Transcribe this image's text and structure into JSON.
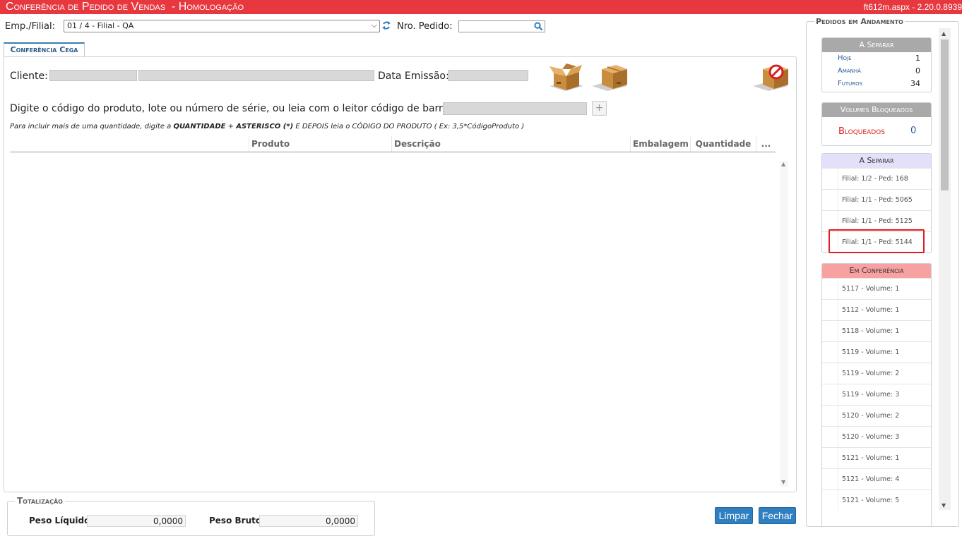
{
  "window": {
    "title": "Conferência de Pedido de Vendas",
    "environment": "- Homologação",
    "version": "ft612m.aspx - 2.20.0.8939"
  },
  "filters": {
    "emp_label": "Emp./Filial:",
    "emp_value": "01 / 4 - Filial - QA",
    "pedido_label": "Nro. Pedido:",
    "pedido_value": ""
  },
  "tab": {
    "label": "Conferência Cega"
  },
  "form": {
    "cliente_label": "Cliente:",
    "data_emissao_label": "Data Emissão:",
    "barcode_label": "Digite o código do produto, lote ou número de série, ou leia com o leitor código de barras:",
    "add_label": "+",
    "hint": {
      "p1": "Para incluir mais de uma quantidade, digite a ",
      "b1": "QUANTIDADE",
      "p2": " + ",
      "b2": "ASTERISCO (*)",
      "p3": " E DEPOIS leia o CÓDIGO DO PRODUTO ( Ex: 3,5*CódigoProduto )"
    }
  },
  "grid": {
    "columns": [
      "",
      "Produto",
      "Descrição",
      "Embalagem",
      "Quantidade",
      "..."
    ],
    "rows": []
  },
  "totals": {
    "title": "Totalização",
    "peso_liquido_label": "Peso Líquido:",
    "peso_liquido": "0,0000",
    "peso_bruto_label": "Peso Bruto:",
    "peso_bruto": "0,0000"
  },
  "buttons": {
    "limpar": "Limpar",
    "fechar": "Fechar"
  },
  "sidebar": {
    "title": "Pedidos em Andamento",
    "summary": {
      "title": "A Separar",
      "rows": [
        {
          "label": "Hoje",
          "value": "1"
        },
        {
          "label": "Amanhã",
          "value": "0"
        },
        {
          "label": "Futuros",
          "value": "34"
        }
      ]
    },
    "blocked": {
      "title": "Volumes Bloqueados",
      "label": "Bloqueados",
      "value": "0"
    },
    "a_separar": {
      "title": "A Separar",
      "items": [
        "Filial: 1/2 - Ped: 168",
        "Filial: 1/1 - Ped: 5065",
        "Filial: 1/1 - Ped: 5125",
        "Filial: 1/1 - Ped: 5144"
      ]
    },
    "em_conferencia": {
      "title": "Em Conferência",
      "items": [
        "5117 - Volume: 1",
        "5112 - Volume: 1",
        "5118 - Volume: 1",
        "5119 - Volume: 1",
        "5119 - Volume: 2",
        "5119 - Volume: 3",
        "5120 - Volume: 2",
        "5120 - Volume: 3",
        "5121 - Volume: 1",
        "5121 - Volume: 4",
        "5121 - Volume: 5"
      ]
    }
  }
}
